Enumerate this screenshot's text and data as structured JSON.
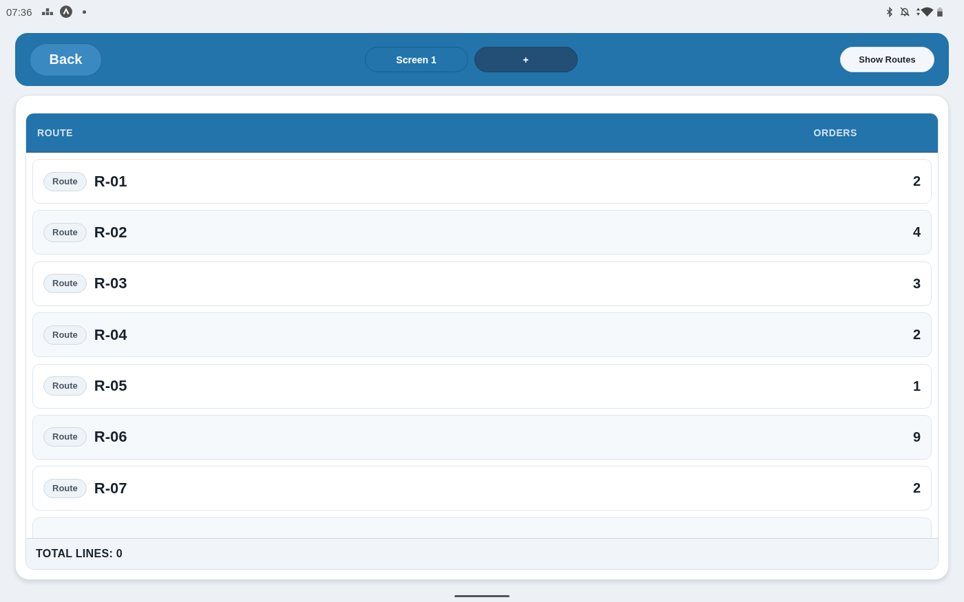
{
  "status_bar": {
    "time": "07:36"
  },
  "header": {
    "back_button": "Back",
    "tabs": [
      {
        "label": "Screen 1",
        "kind": "tab"
      },
      {
        "label": "+",
        "kind": "add"
      }
    ],
    "show_routes_button": "Show Routes"
  },
  "table": {
    "columns": [
      "ROUTE",
      "ORDERS"
    ],
    "rows": [
      {
        "badge": "Route",
        "route": "R-01",
        "orders": "2"
      },
      {
        "badge": "Route",
        "route": "R-02",
        "orders": "4"
      },
      {
        "badge": "Route",
        "route": "R-03",
        "orders": "3"
      },
      {
        "badge": "Route",
        "route": "R-04",
        "orders": "2"
      },
      {
        "badge": "Route",
        "route": "R-05",
        "orders": "1"
      },
      {
        "badge": "Route",
        "route": "R-06",
        "orders": "9"
      },
      {
        "badge": "Route",
        "route": "R-07",
        "orders": "2"
      },
      {}
    ],
    "footer": "TOTAL LINES: 0"
  }
}
